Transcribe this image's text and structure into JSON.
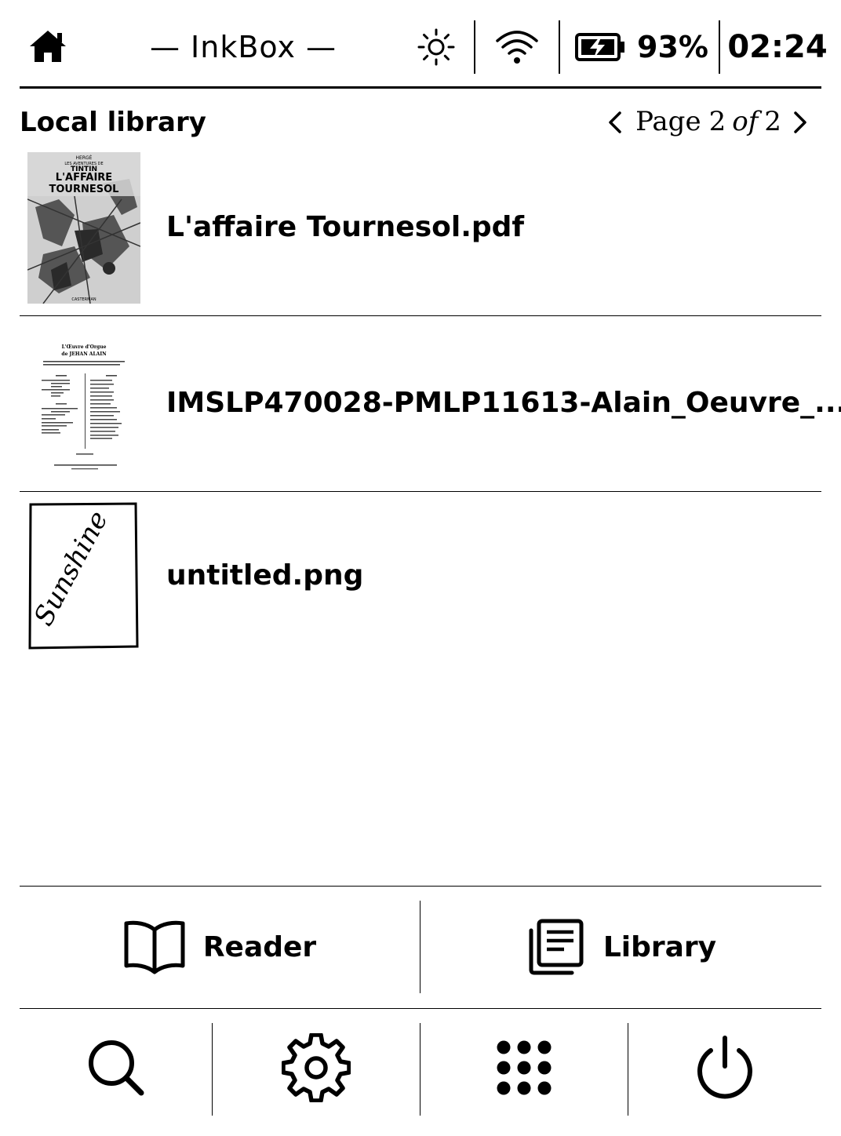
{
  "status_bar": {
    "title": "— InkBox —",
    "battery_percent": "93%",
    "time": "02:24",
    "icons": {
      "home": "home-icon",
      "brightness": "brightness-icon",
      "wifi": "wifi-icon",
      "battery": "battery-charging-icon"
    }
  },
  "library": {
    "title": "Local library",
    "pager": {
      "prefix": "Page",
      "current": "2",
      "of_word": "of",
      "total": "2",
      "prev_icon": "chevron-left-icon",
      "next_icon": "chevron-right-icon"
    },
    "books": [
      {
        "name": "L'affaire Tournesol.pdf",
        "cover_lines": [
          "HERGÉ",
          "LES AVENTURES DE",
          "TINTIN",
          "L'AFFAIRE",
          "TOURNESOL",
          "CASTERMAN"
        ]
      },
      {
        "name": "IMSLP470028-PMLP11613-Alain_Oeuvre_...",
        "cover_lines": [
          "L'Œuvre d'Orgue",
          "de JEHAN ALAIN"
        ]
      },
      {
        "name": "untitled.png",
        "cover_lines": [
          "Sunshine"
        ]
      }
    ]
  },
  "bottom_nav": {
    "reader_label": "Reader",
    "library_label": "Library",
    "reader_icon": "open-book-icon",
    "library_icon": "library-stack-icon"
  },
  "toolbar": {
    "search_icon": "search-icon",
    "settings_icon": "gear-icon",
    "apps_icon": "app-grid-icon",
    "power_icon": "power-icon"
  }
}
